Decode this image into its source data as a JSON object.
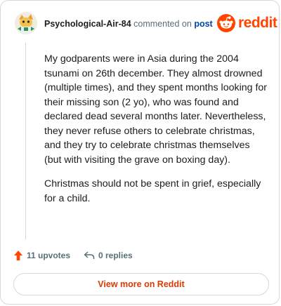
{
  "comment": {
    "username": "Psychological-Air-84",
    "action_text": "commented on",
    "post_link_label": "post",
    "paragraphs": [
      "My godparents were in Asia during the 2004 tsunami on 26th december. They almost drowned (multiple times), and they spent months looking for their missing son (2 yo), who was found and declared dead several months later. Nevertheless, they never refuse others to celebrate christmas, and they try to celebrate christmas themselves (but with visiting the grave on boxing day).",
      "Christmas should not be spent in grief, especially for a child."
    ]
  },
  "brand": {
    "logo_text": "reddit",
    "accent_color": "#ff4500"
  },
  "footer": {
    "upvotes_label": "11 upvotes",
    "replies_label": "0 replies",
    "upvote_icon": "upvote-arrow-icon",
    "reply_icon": "reply-arrow-icon"
  },
  "cta": {
    "label": "View more on Reddit",
    "color": "#d93a00"
  }
}
